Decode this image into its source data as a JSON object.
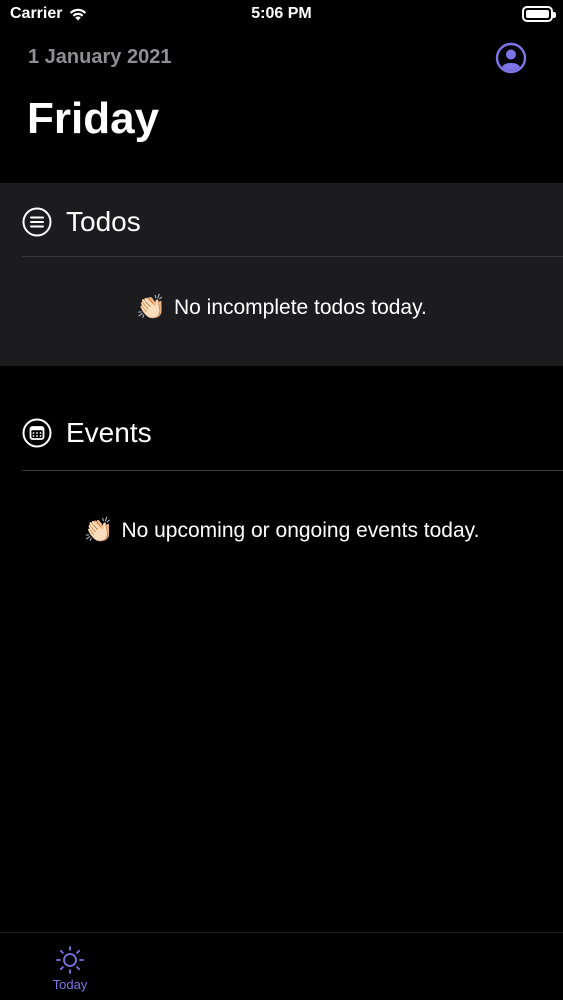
{
  "status_bar": {
    "carrier": "Carrier",
    "time": "5:06 PM"
  },
  "header": {
    "date": "1 January 2021",
    "day": "Friday"
  },
  "todos": {
    "title": "Todos",
    "empty_emoji": "👏🏻",
    "empty_message": "No incomplete todos today."
  },
  "events": {
    "title": "Events",
    "empty_emoji": "👏🏻",
    "empty_message": "No upcoming or ongoing events today."
  },
  "tab_bar": {
    "tabs": [
      {
        "label": "Today",
        "icon": "sun-icon",
        "active": true
      }
    ]
  },
  "colors": {
    "accent": "#7d75e6",
    "background": "#000000",
    "card": "#1c1c1e",
    "secondary_text": "#8e8e93"
  }
}
